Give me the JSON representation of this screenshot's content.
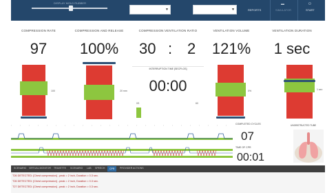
{
  "toolbar": {
    "slider_label": "DISPLAY MOLD RUBBER",
    "reports_label": "REPORTS",
    "btn2_label": "SIMULATOR",
    "btn3_label": "START"
  },
  "panels": [
    {
      "title": "COMPRESSION RATE",
      "value": "97",
      "side_label": "100"
    },
    {
      "title": "COMPRESSION AND RELEASE",
      "value": "100%",
      "side_label": "20 mm"
    },
    {
      "title": "COMPRESSION:VENTILATION RATIO",
      "value_left": "30",
      "value_sep": ":",
      "value_right": "2",
      "sub_title": "INTERRUPTION TIME [SECPLOS]",
      "sub_value": "00:00",
      "scale_left": "0S",
      "scale_right": "60"
    },
    {
      "title": "VENTILATION VOLUME",
      "value": "121%",
      "side_label": "0%"
    },
    {
      "title": "VENTILATION DURATION",
      "value": "1 sec",
      "side_label": "1 sec"
    }
  ],
  "right": {
    "cycles_label": "COMPLETED CYCLES",
    "cycles_value": "07",
    "time_label": "TIME OF CPR",
    "time_value": "00:01",
    "lungs_label": "UNOBSTRUCTED TUBE"
  },
  "tabs": [
    "SCENARIO",
    "VIRTUAL MONITOR",
    "TRAVETTE",
    "SCENARIO",
    "LAB",
    "SPEECH",
    "CPR",
    "PROVIDER ACTIONS"
  ],
  "active_tab": 6,
  "log": [
    "T26 DETECTED: [Chest compression] - peak = 2 inch, Duration = 0.3 sec.",
    "T26 DETECTED: [Chest compression] - peak = 2 inch, Duration = 0.3 sec.",
    "T27 DETECTED: [Chest compression] - peak = 2 inch, Duration = 0.3 sec."
  ],
  "colors": {
    "navy": "#24476b",
    "red": "#dd3b32",
    "green": "#8dc63f",
    "marker": "#2c4f74",
    "tab_active": "#2f6aa0"
  }
}
